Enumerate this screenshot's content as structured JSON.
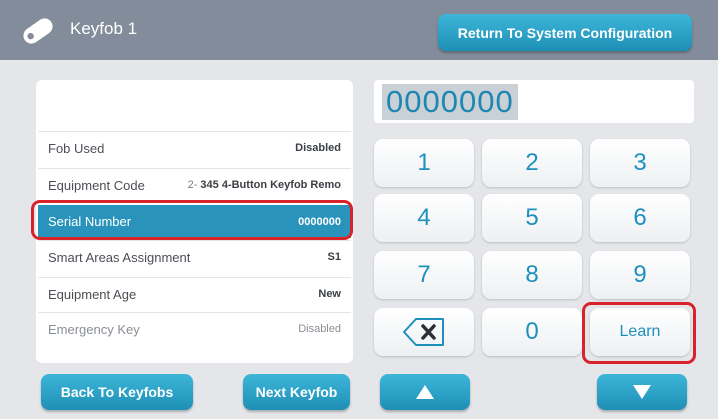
{
  "header": {
    "title": "Keyfob 1",
    "return_label": "Return To System Configuration",
    "icon": "keyfob-icon"
  },
  "settings": {
    "rows": [
      {
        "label": "Fob Used",
        "value": "Disabled"
      },
      {
        "label": "Equipment Code",
        "value_prefix": "2-",
        "value": "345 4-Button Keyfob Remo"
      },
      {
        "label": "Serial Number",
        "value": "0000000",
        "selected": true
      },
      {
        "label": "Smart Areas Assignment",
        "value": "S1"
      },
      {
        "label": "Equipment Age",
        "value": "New"
      },
      {
        "label": "Emergency Key",
        "value": "Disabled"
      }
    ]
  },
  "footer": {
    "back_label": "Back To Keyfobs",
    "next_label": "Next Keyfob",
    "up_icon": "arrow-up-icon",
    "down_icon": "arrow-down-icon"
  },
  "display": {
    "value": "0000000"
  },
  "keypad": {
    "keys": [
      "1",
      "2",
      "3",
      "4",
      "5",
      "6",
      "7",
      "8",
      "9",
      "0"
    ],
    "learn_label": "Learn",
    "backspace_icon": "backspace-icon"
  },
  "colors": {
    "accent": "#1e90bd",
    "header": "#838c9a",
    "highlight": "#d8232a",
    "selected_row": "#2a93bc"
  }
}
